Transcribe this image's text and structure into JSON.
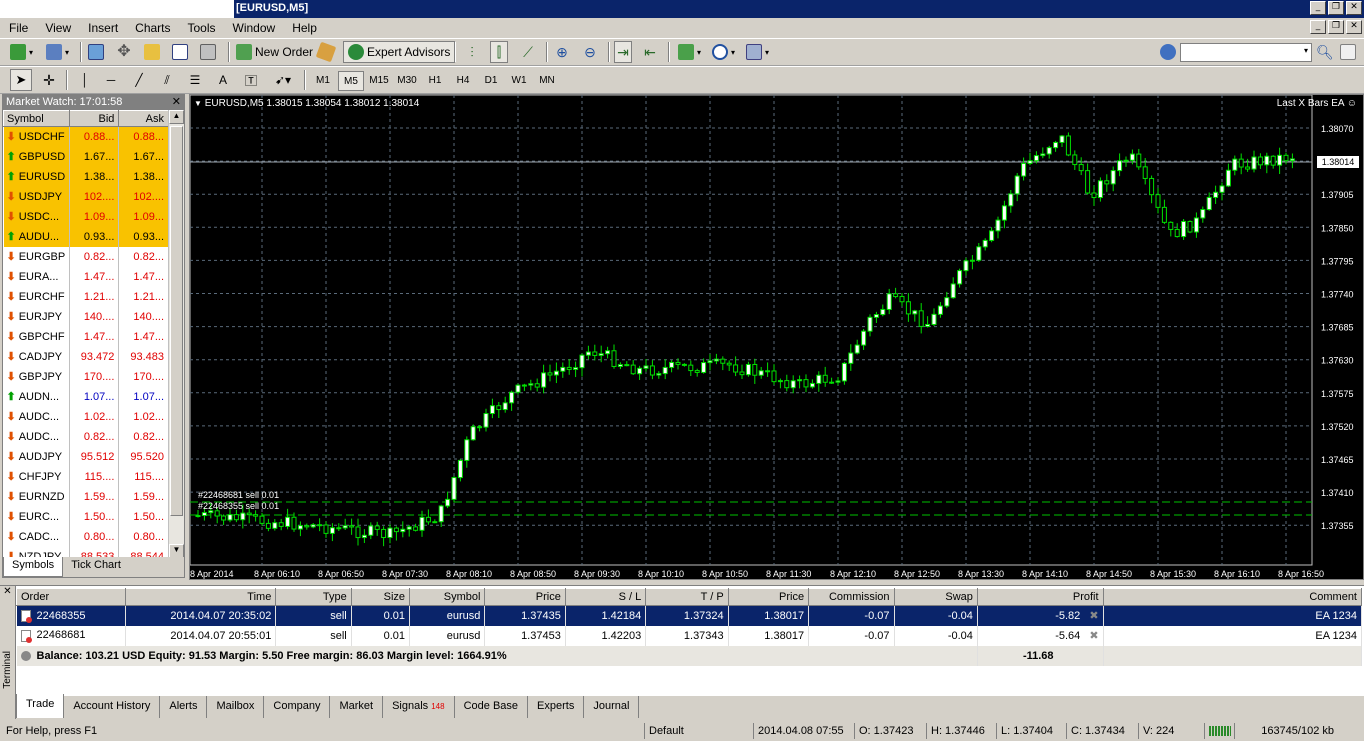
{
  "window": {
    "title": "[EURUSD,M5]"
  },
  "menu": [
    "File",
    "View",
    "Insert",
    "Charts",
    "Tools",
    "Window",
    "Help"
  ],
  "toolbar": {
    "new_order": "New Order",
    "expert_advisors": "Expert Advisors"
  },
  "timeframes": [
    "M1",
    "M5",
    "M15",
    "M30",
    "H1",
    "H4",
    "D1",
    "W1",
    "MN"
  ],
  "market_watch": {
    "title": "Market Watch: 17:01:58",
    "headers": [
      "Symbol",
      "Bid",
      "Ask"
    ],
    "rows": [
      {
        "dir": "down",
        "symbol": "USDCHF",
        "bid": "0.88...",
        "ask": "0.88...",
        "hl": true,
        "color": "#e00000"
      },
      {
        "dir": "up",
        "symbol": "GBPUSD",
        "bid": "1.67...",
        "ask": "1.67...",
        "hl": true,
        "color": "#000000"
      },
      {
        "dir": "up",
        "symbol": "EURUSD",
        "bid": "1.38...",
        "ask": "1.38...",
        "hl": true,
        "color": "#000000"
      },
      {
        "dir": "down",
        "symbol": "USDJPY",
        "bid": "102....",
        "ask": "102....",
        "hl": true,
        "color": "#e00000"
      },
      {
        "dir": "down",
        "symbol": "USDC...",
        "bid": "1.09...",
        "ask": "1.09...",
        "hl": true,
        "color": "#e00000"
      },
      {
        "dir": "up",
        "symbol": "AUDU...",
        "bid": "0.93...",
        "ask": "0.93...",
        "hl": true,
        "color": "#000000"
      },
      {
        "dir": "down",
        "symbol": "EURGBP",
        "bid": "0.82...",
        "ask": "0.82...",
        "hl": false,
        "color": "#e00000"
      },
      {
        "dir": "down",
        "symbol": "EURA...",
        "bid": "1.47...",
        "ask": "1.47...",
        "hl": false,
        "color": "#e00000"
      },
      {
        "dir": "down",
        "symbol": "EURCHF",
        "bid": "1.21...",
        "ask": "1.21...",
        "hl": false,
        "color": "#e00000"
      },
      {
        "dir": "down",
        "symbol": "EURJPY",
        "bid": "140....",
        "ask": "140....",
        "hl": false,
        "color": "#e00000"
      },
      {
        "dir": "down",
        "symbol": "GBPCHF",
        "bid": "1.47...",
        "ask": "1.47...",
        "hl": false,
        "color": "#e00000"
      },
      {
        "dir": "down",
        "symbol": "CADJPY",
        "bid": "93.472",
        "ask": "93.483",
        "hl": false,
        "color": "#e00000"
      },
      {
        "dir": "down",
        "symbol": "GBPJPY",
        "bid": "170....",
        "ask": "170....",
        "hl": false,
        "color": "#e00000"
      },
      {
        "dir": "up",
        "symbol": "AUDN...",
        "bid": "1.07...",
        "ask": "1.07...",
        "hl": false,
        "color": "#0000c0"
      },
      {
        "dir": "down",
        "symbol": "AUDC...",
        "bid": "1.02...",
        "ask": "1.02...",
        "hl": false,
        "color": "#e00000"
      },
      {
        "dir": "down",
        "symbol": "AUDC...",
        "bid": "0.82...",
        "ask": "0.82...",
        "hl": false,
        "color": "#e00000"
      },
      {
        "dir": "down",
        "symbol": "AUDJPY",
        "bid": "95.512",
        "ask": "95.520",
        "hl": false,
        "color": "#e00000"
      },
      {
        "dir": "down",
        "symbol": "CHFJPY",
        "bid": "115....",
        "ask": "115....",
        "hl": false,
        "color": "#e00000"
      },
      {
        "dir": "down",
        "symbol": "EURNZD",
        "bid": "1.59...",
        "ask": "1.59...",
        "hl": false,
        "color": "#e00000"
      },
      {
        "dir": "down",
        "symbol": "EURC...",
        "bid": "1.50...",
        "ask": "1.50...",
        "hl": false,
        "color": "#e00000"
      },
      {
        "dir": "down",
        "symbol": "CADC...",
        "bid": "0.80...",
        "ask": "0.80...",
        "hl": false,
        "color": "#e00000"
      },
      {
        "dir": "down",
        "symbol": "NZDJPY",
        "bid": "88.533",
        "ask": "88.544",
        "hl": false,
        "color": "#e00000"
      }
    ],
    "tabs": [
      "Symbols",
      "Tick Chart"
    ]
  },
  "chart": {
    "header": "EURUSD,M5  1.38015 1.38054 1.38012 1.38014",
    "ea_label": "Last X Bars EA",
    "current_price": "1.38014",
    "price_ticks": [
      "1.38070",
      "1.37960",
      "1.37905",
      "1.37850",
      "1.37795",
      "1.37740",
      "1.37685",
      "1.37630",
      "1.37575",
      "1.37520",
      "1.37465",
      "1.37410",
      "1.37355"
    ],
    "time_ticks": [
      "8 Apr 2014",
      "8 Apr 06:10",
      "8 Apr 06:50",
      "8 Apr 07:30",
      "8 Apr 08:10",
      "8 Apr 08:50",
      "8 Apr 09:30",
      "8 Apr 10:10",
      "8 Apr 10:50",
      "8 Apr 11:30",
      "8 Apr 12:10",
      "8 Apr 12:50",
      "8 Apr 13:30",
      "8 Apr 14:10",
      "8 Apr 14:50",
      "8 Apr 15:30",
      "8 Apr 16:10",
      "8 Apr 16:50"
    ],
    "order_labels": [
      "#22468681 sell 0.01",
      "#22468355 sell 0.01"
    ]
  },
  "terminal": {
    "headers": [
      "Order",
      "Time",
      "Type",
      "Size",
      "Symbol",
      "Price",
      "S / L",
      "T / P",
      "Price",
      "Commission",
      "Swap",
      "Profit",
      "Comment"
    ],
    "rows": [
      [
        "22468355",
        "2014.04.07 20:35:02",
        "sell",
        "0.01",
        "eurusd",
        "1.37435",
        "1.42184",
        "1.37324",
        "1.38017",
        "-0.07",
        "-0.04",
        "-5.82",
        "EA 1234"
      ],
      [
        "22468681",
        "2014.04.07 20:55:01",
        "sell",
        "0.01",
        "eurusd",
        "1.37453",
        "1.42203",
        "1.37343",
        "1.38017",
        "-0.07",
        "-0.04",
        "-5.64",
        "EA 1234"
      ]
    ],
    "balance": "Balance: 103.21 USD  Equity: 91.53  Margin: 5.50  Free margin: 86.03  Margin level: 1664.91%",
    "total": "-11.68",
    "side_label": "Terminal",
    "tabs": [
      "Trade",
      "Account History",
      "Alerts",
      "Mailbox",
      "Company",
      "Market",
      "Signals",
      "Code Base",
      "Experts",
      "Journal"
    ],
    "signals_badge": "148"
  },
  "status": {
    "help": "For Help, press F1",
    "profile": "Default",
    "time": "2014.04.08 07:55",
    "open": "O: 1.37423",
    "high": "H: 1.37446",
    "low": "L: 1.37404",
    "close": "C: 1.37434",
    "volume": "V: 224",
    "traffic": "163745/102 kb"
  }
}
